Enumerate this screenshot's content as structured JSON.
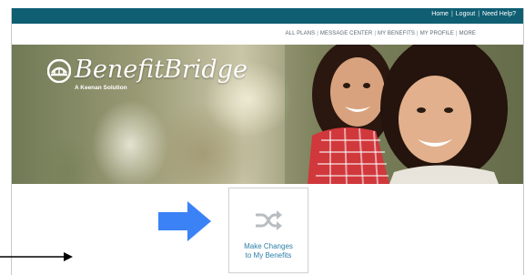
{
  "header": {
    "links": [
      {
        "label": "Home"
      },
      {
        "label": "Logout"
      },
      {
        "label": "Need Help?"
      }
    ]
  },
  "subnav": {
    "items": [
      {
        "label": "ALL PLANS"
      },
      {
        "label": "MESSAGE CENTER"
      },
      {
        "label": "MY BENEFITS"
      },
      {
        "label": "MY PROFILE"
      },
      {
        "label": "MORE"
      }
    ]
  },
  "hero": {
    "brand": "BenefitBridge",
    "tagline": "A Keenan Solution"
  },
  "tile": {
    "label_line1": "Make Changes",
    "label_line2": "to My Benefits",
    "icon": "shuffle-icon"
  },
  "annotations": {
    "big_arrow": "right-arrow-icon",
    "pointer_arrow": "pointer-arrow-icon"
  },
  "colors": {
    "topbar": "#0f5e72",
    "link": "#2b7fa6",
    "arrow": "#3b82f6"
  }
}
